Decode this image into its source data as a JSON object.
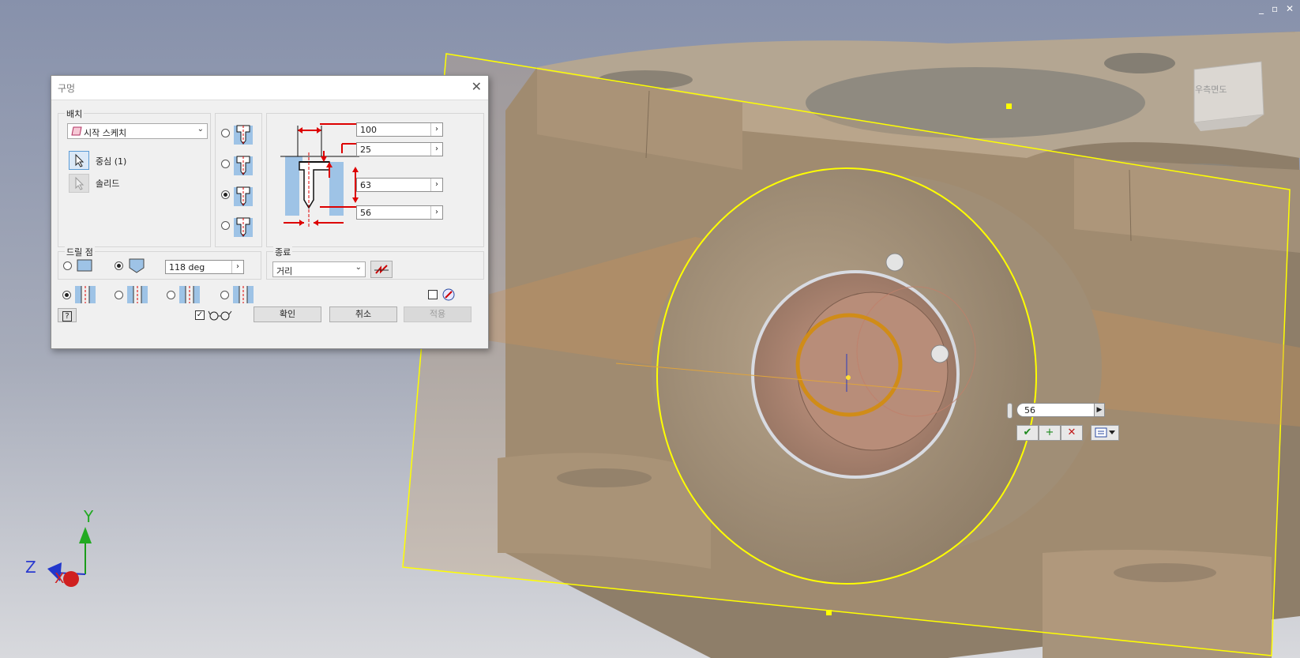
{
  "window_controls": {
    "minimize": "_",
    "restore": "▫",
    "close": "✕"
  },
  "viewcube": {
    "label": "우측면도"
  },
  "axes": {
    "x": "X",
    "y": "Y",
    "z": "Z"
  },
  "dialog": {
    "title": "구멍",
    "close": "✕",
    "placement": {
      "label": "배치",
      "select_value": "시작 스케치",
      "center_label": "중심 (1)",
      "solid_label": "솔리드"
    },
    "hole_types": [
      {
        "icon": "simple-hole-icon",
        "selected": false
      },
      {
        "icon": "counterbore-hole-icon",
        "selected": false
      },
      {
        "icon": "spotface-hole-icon",
        "selected": true
      },
      {
        "icon": "countersink-hole-icon",
        "selected": false
      }
    ],
    "dimensions": [
      {
        "value": "100"
      },
      {
        "value": "25"
      },
      {
        "value": "63"
      },
      {
        "value": "56"
      }
    ],
    "drill_point": {
      "label": "드릴 점",
      "flat_selected": false,
      "angle_selected": true,
      "angle_value": "118 deg"
    },
    "termination": {
      "label": "종료",
      "select_value": "거리"
    },
    "thread_types": [
      {
        "icon": "simple-drill-icon",
        "selected": true
      },
      {
        "icon": "clearance-hole-icon",
        "selected": false
      },
      {
        "icon": "tapped-hole-icon",
        "selected": false
      },
      {
        "icon": "taper-tapped-hole-icon",
        "selected": false
      }
    ],
    "help": "?",
    "preview_checked": true,
    "buttons": {
      "ok": "확인",
      "cancel": "취소",
      "apply": "적용"
    }
  },
  "mini_toolbar": {
    "value": "56",
    "apply": "✔",
    "add": "+",
    "cancel": "✕"
  },
  "colors": {
    "background_top": "#7f8aa6",
    "background_bottom": "#d4d5d9",
    "part": "#a9977f",
    "highlight": "#ffff00",
    "dialog": "#f0f0f0",
    "dimension_arrow": "#d00000"
  }
}
